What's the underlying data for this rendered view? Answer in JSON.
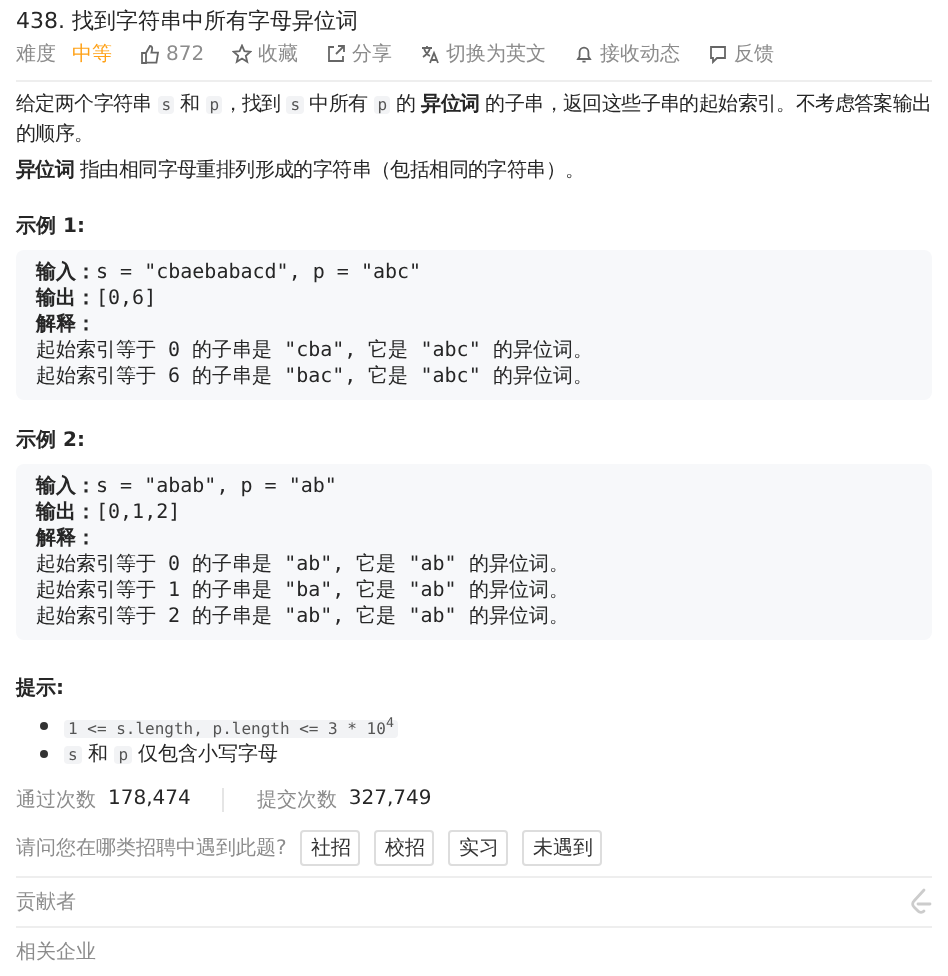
{
  "title": "438. 找到字符串中所有字母异位词",
  "meta": {
    "difficulty_label": "难度",
    "difficulty": "中等",
    "actions": [
      {
        "kind": "like",
        "label": "872"
      },
      {
        "kind": "star",
        "label": "收藏"
      },
      {
        "kind": "share",
        "label": "分享"
      },
      {
        "kind": "translate",
        "label": "切换为英文"
      },
      {
        "kind": "bell",
        "label": "接收动态"
      },
      {
        "kind": "flag",
        "label": "反馈"
      }
    ]
  },
  "description": [
    [
      {
        "kind": "text",
        "text": "给定两个字符串 "
      },
      {
        "kind": "code",
        "text": "s"
      },
      {
        "kind": "text",
        "text": " 和 "
      },
      {
        "kind": "code",
        "text": "p"
      },
      {
        "kind": "text",
        "text": "，找到 "
      },
      {
        "kind": "code",
        "text": "s"
      },
      {
        "kind": "text",
        "text": " 中所有 "
      },
      {
        "kind": "code",
        "text": "p"
      },
      {
        "kind": "text",
        "text": " 的 "
      },
      {
        "kind": "bold",
        "text": "异位词"
      },
      {
        "kind": "text",
        "text": " 的子串，返回这些子串的起始索引。不考虑答案输出的顺序。"
      }
    ],
    [
      {
        "kind": "bold",
        "text": "异位词"
      },
      {
        "kind": "text",
        "text": " 指由相同字母重排列形成的字符串（包括相同的字符串）。"
      }
    ]
  ],
  "examples": [
    {
      "title": "示例 1:",
      "lines": [
        {
          "label": "输入：",
          "text": "s = \"cbaebabacd\", p = \"abc\""
        },
        {
          "label": "输出：",
          "text": "[0,6]"
        },
        {
          "label": "解释："
        },
        {
          "text": "起始索引等于 0 的子串是 \"cba\", 它是 \"abc\" 的异位词。"
        },
        {
          "text": "起始索引等于 6 的子串是 \"bac\", 它是 \"abc\" 的异位词。"
        }
      ]
    },
    {
      "title": "示例 2:",
      "lines": [
        {
          "label": "输入：",
          "text": "s = \"abab\", p = \"ab\""
        },
        {
          "label": "输出：",
          "text": "[0,1,2]"
        },
        {
          "label": "解释："
        },
        {
          "text": "起始索引等于 0 的子串是 \"ab\", 它是 \"ab\" 的异位词。"
        },
        {
          "text": "起始索引等于 1 的子串是 \"ba\", 它是 \"ab\" 的异位词。"
        },
        {
          "text": "起始索引等于 2 的子串是 \"ab\", 它是 \"ab\" 的异位词。"
        }
      ]
    }
  ],
  "hints_title": "提示:",
  "hints": [
    [
      {
        "kind": "code",
        "text": "1 <= s.length, p.length <= 3 * 10$^{4}$"
      }
    ],
    [
      {
        "kind": "code",
        "text": "s"
      },
      {
        "kind": "text",
        "text": " 和 "
      },
      {
        "kind": "code",
        "text": "p"
      },
      {
        "kind": "text",
        "text": " 仅包含小写字母"
      }
    ]
  ],
  "stats": [
    {
      "label": "通过次数",
      "value": "178,474"
    },
    {
      "label": "提交次数",
      "value": "327,749"
    }
  ],
  "survey": {
    "question": "请问您在哪类招聘中遇到此题?",
    "options": [
      "社招",
      "校招",
      "实习",
      "未遇到"
    ]
  },
  "sections": [
    "贡献者",
    "相关企业"
  ]
}
